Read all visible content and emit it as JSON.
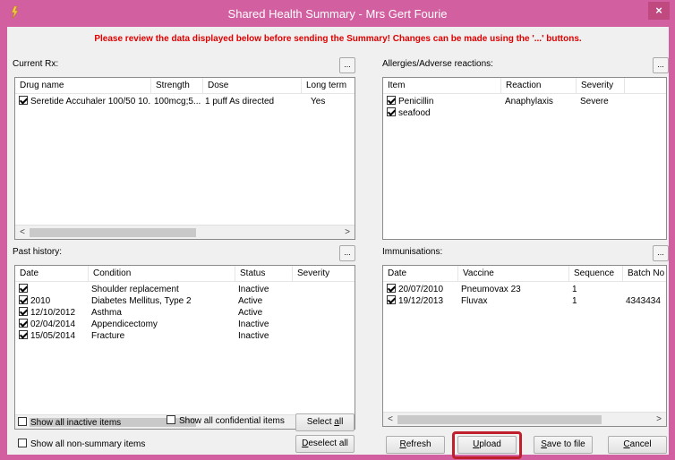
{
  "window": {
    "title": "Shared Health Summary - Mrs Gert Fourie",
    "close_label": "×"
  },
  "warning": "Please review the data displayed below before sending the Summary!  Changes can be made using the '...' buttons.",
  "edit_button_label": "...",
  "current_rx": {
    "label": "Current Rx:",
    "columns": [
      "Drug name",
      "Strength",
      "Dose",
      "Long term"
    ],
    "rows": [
      {
        "checked": true,
        "drug": "Seretide Accuhaler 100/50 10...",
        "strength": "100mcg;5...",
        "dose": "1 puff As directed",
        "long_term": "Yes"
      }
    ]
  },
  "allergies": {
    "label": "Allergies/Adverse reactions:",
    "columns": [
      "Item",
      "Reaction",
      "Severity"
    ],
    "rows": [
      {
        "checked": true,
        "item": "Penicillin",
        "reaction": "Anaphylaxis",
        "severity": "Severe"
      },
      {
        "checked": true,
        "item": "seafood",
        "reaction": "",
        "severity": ""
      }
    ]
  },
  "past_history": {
    "label": "Past history:",
    "columns": [
      "Date",
      "Condition",
      "Status",
      "Severity"
    ],
    "rows": [
      {
        "checked": true,
        "date": "",
        "condition": "Shoulder replacement",
        "status": "Inactive"
      },
      {
        "checked": true,
        "date": "2010",
        "condition": "Diabetes Mellitus, Type 2",
        "status": "Active"
      },
      {
        "checked": true,
        "date": "12/10/2012",
        "condition": "Asthma",
        "status": "Active"
      },
      {
        "checked": true,
        "date": "02/04/2014",
        "condition": "Appendicectomy",
        "status": "Inactive"
      },
      {
        "checked": true,
        "date": "15/05/2014",
        "condition": "Fracture",
        "status": "Inactive"
      }
    ]
  },
  "immunisations": {
    "label": "Immunisations:",
    "columns": [
      "Date",
      "Vaccine",
      "Sequence",
      "Batch No"
    ],
    "rows": [
      {
        "checked": true,
        "date": "20/07/2010",
        "vaccine": "Pneumovax 23",
        "sequence": "1",
        "batch": ""
      },
      {
        "checked": true,
        "date": "19/12/2013",
        "vaccine": "Fluvax",
        "sequence": "1",
        "batch": "4343434"
      }
    ]
  },
  "options": {
    "show_inactive": "Show all inactive items",
    "show_confidential": "Show all confidential items",
    "show_non_summary": "Show all non-summary items"
  },
  "buttons": {
    "select_all_pre": "Select ",
    "select_all_key": "a",
    "select_all_post": "ll",
    "deselect_all_pre": "",
    "deselect_all_key": "D",
    "deselect_all_post": "eselect all",
    "refresh_key": "R",
    "refresh_post": "efresh",
    "upload_key": "U",
    "upload_post": "pload",
    "save_pre": "",
    "save_key": "S",
    "save_post": "ave to file",
    "cancel_key": "C",
    "cancel_post": "ancel"
  },
  "icons": {
    "app": "window-app-icon",
    "close": "close-icon",
    "scroll_left": "scroll-left-arrow-icon",
    "scroll_right": "scroll-right-arrow-icon"
  }
}
